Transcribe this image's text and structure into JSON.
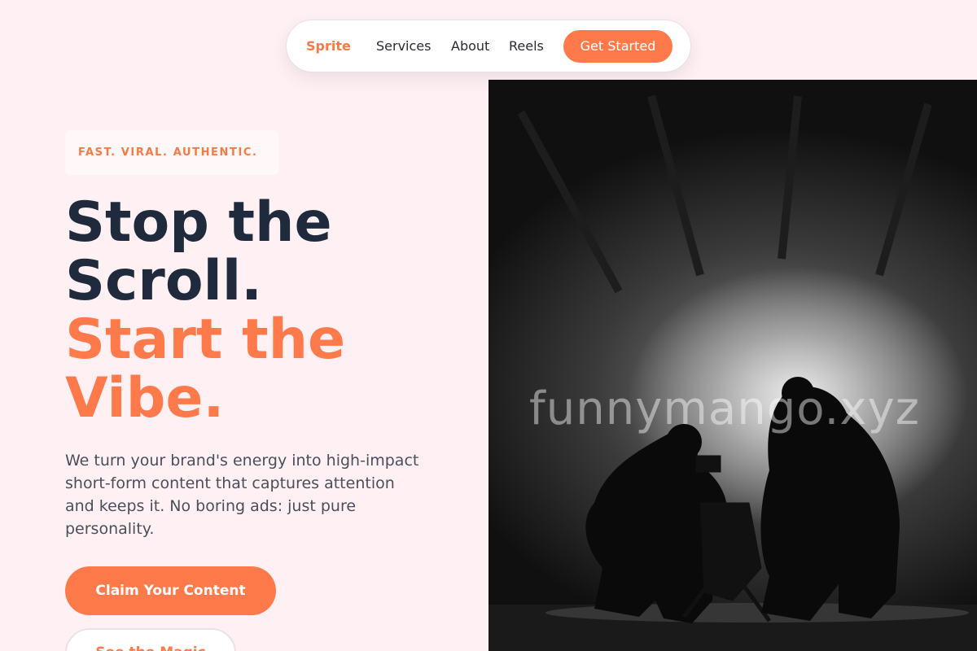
{
  "nav": {
    "brand": "Sprite",
    "links": [
      "Services",
      "About",
      "Reels"
    ],
    "cta": "Get Started"
  },
  "hero": {
    "badge": "FAST. VIRAL. AUTHENTIC.",
    "headline_line1": "Stop the",
    "headline_line2": "Scroll.",
    "headline_line3": "Start the",
    "headline_line4": "Vibe.",
    "description": "We turn your brand's energy into high-impact short-form content that captures attention and keeps it. No boring ads: just pure personality.",
    "primary_button": "Claim Your Content",
    "secondary_button": "See the Magic"
  },
  "image": {
    "watermark": "funnymango.xyz",
    "subject": "film-crew-silhouette"
  },
  "colors": {
    "accent": "#ff7a4a",
    "heading": "#1f2a3c",
    "background": "#fff0f4"
  }
}
